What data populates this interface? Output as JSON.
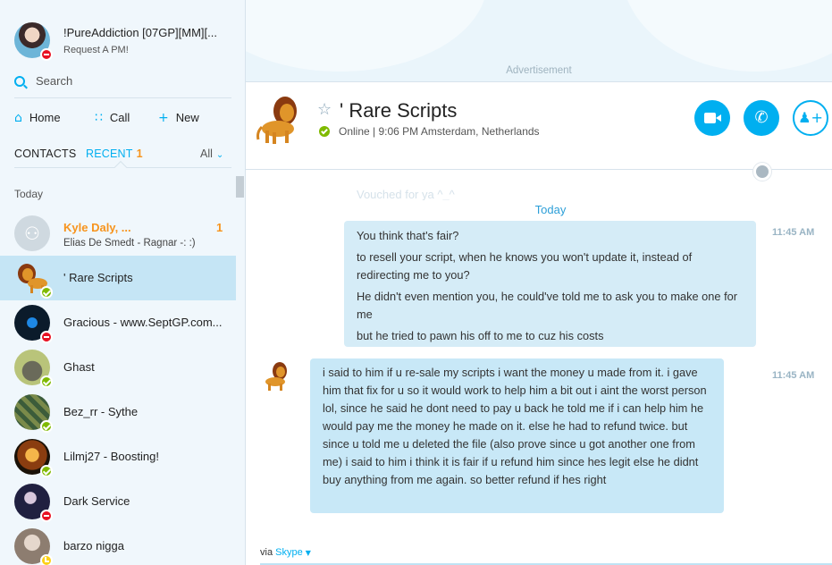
{
  "profile": {
    "name": "!PureAddiction [07GP][MM][...",
    "mood": "Request A PM!",
    "status": "do-not-disturb"
  },
  "search": {
    "placeholder": "Search"
  },
  "nav": {
    "home": "Home",
    "call": "Call",
    "new": "New"
  },
  "tabs": {
    "contacts": "CONTACTS",
    "recent": "RECENT",
    "recent_count": "1",
    "filter": "All"
  },
  "list_section": "Today",
  "contacts": [
    {
      "name": "Kyle Daly, ...",
      "sub": "Elias De Smedt - Ragnar -: :)",
      "badge": "1",
      "status": "group",
      "icon": "group-icon"
    },
    {
      "name": "' Rare Scripts",
      "status": "online",
      "icon": "lion-avatar"
    },
    {
      "name": "Gracious - www.SeptGP.com...",
      "status": "do-not-disturb",
      "icon": "droplet-avatar"
    },
    {
      "name": "Ghast",
      "status": "online",
      "icon": "elephant-avatar"
    },
    {
      "name": "Bez_rr - Sythe",
      "status": "online",
      "icon": "map-avatar"
    },
    {
      "name": "Lilmj27 - Boosting!",
      "status": "online",
      "icon": "fire-avatar"
    },
    {
      "name": "Dark Service",
      "status": "do-not-disturb",
      "icon": "anime-avatar"
    },
    {
      "name": "barzo nigga",
      "status": "away",
      "icon": "photo-avatar"
    }
  ],
  "ad": {
    "label": "Advertisement"
  },
  "chat": {
    "title": "' Rare Scripts",
    "status_line": "Online  |  9:06 PM Amsterdam, Netherlands",
    "faded_text": "Vouched for ya ^_^",
    "day_divider": "Today",
    "messages": [
      {
        "time": "11:45 AM",
        "direction": "outgoing",
        "lines": [
          "You think that's fair?",
          "to resell your script, when he knows you won't update it, instead of redirecting me to you?",
          "He didn't even mention you, he could've told me to ask you to make one for me",
          "but he tried to pawn his off to me to cuz his costs"
        ]
      },
      {
        "time": "11:45 AM",
        "direction": "incoming",
        "lines": [
          "i said to him if u re-sale my scripts i want the money u made from it. i gave him that fix for u so it would work to help him a bit out i aint the worst person lol, since he said he dont need to pay u back he told me if i can help him he would pay me  the money he made on it. else he had to refund twice. but since u told me u deleted the file (also prove since u got another one from me) i said to him i think it is fair if u refund him since hes legit else he didnt buy anything from me again. so better refund if hes right"
        ]
      }
    ]
  },
  "compose": {
    "via": "via",
    "service": "Skype"
  },
  "colors": {
    "accent": "#00aff0",
    "unread": "#f7941d",
    "online": "#7fba00",
    "dnd": "#e81123",
    "away": "#fcd116",
    "bubble": "#d5ecf7"
  },
  "icons": [
    "search-icon",
    "home-icon",
    "dialpad-icon",
    "plus-icon",
    "chevron-down-icon",
    "star-icon",
    "video-icon",
    "phone-icon",
    "add-person-icon",
    "globe-icon"
  ]
}
